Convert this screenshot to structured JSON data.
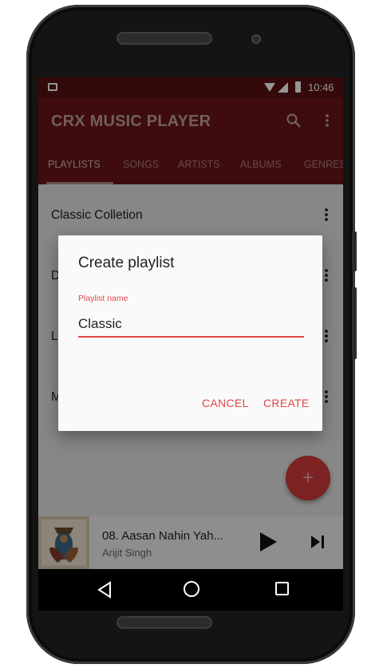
{
  "status_bar": {
    "time": "10:46"
  },
  "toolbar": {
    "title": "CRX MUSIC PLAYER"
  },
  "tabs": [
    {
      "label": "PLAYLISTS"
    },
    {
      "label": "SONGS"
    },
    {
      "label": "ARTISTS"
    },
    {
      "label": "ALBUMS"
    },
    {
      "label": "GENRES"
    }
  ],
  "playlists": [
    {
      "label": "Classic Colletion"
    },
    {
      "label": "D"
    },
    {
      "label": "L"
    },
    {
      "label": "M"
    }
  ],
  "dialog": {
    "title": "Create playlist",
    "field_label": "Playlist name",
    "field_value": "Classic",
    "cancel_label": "CANCEL",
    "create_label": "CREATE"
  },
  "fab": {
    "label": "+"
  },
  "now_playing": {
    "title": "08. Aasan Nahin Yah...",
    "artist": "Arijit Singh"
  },
  "colors": {
    "primary": "#6b1515",
    "accent": "#e24a4a",
    "fab": "#d63b3b"
  },
  "icons": [
    "image-icon",
    "wifi-icon",
    "signal-icon",
    "battery-icon",
    "search-icon",
    "more-vert-icon",
    "play-icon",
    "skip-next-icon",
    "back-icon",
    "home-icon",
    "recents-icon"
  ]
}
